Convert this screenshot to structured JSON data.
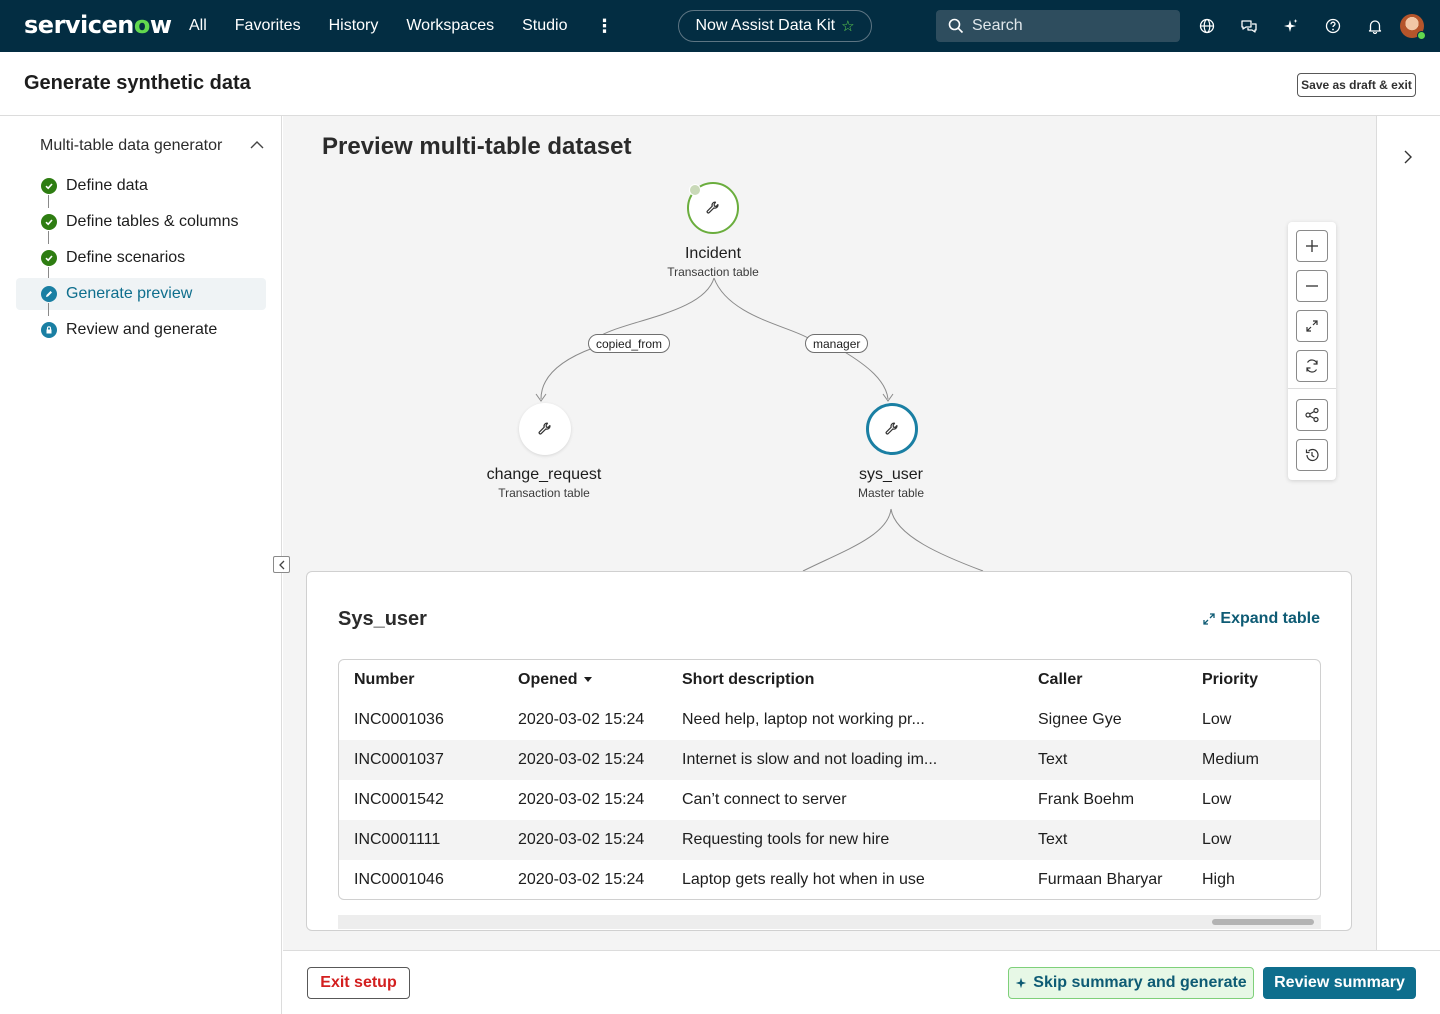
{
  "nav": {
    "logo_prefix": "servicen",
    "logo_o": "o",
    "logo_suffix": "w",
    "links": [
      "All",
      "Favorites",
      "History",
      "Workspaces",
      "Studio"
    ],
    "pill_label": "Now Assist Data Kit",
    "search_placeholder": "Search",
    "icons": [
      "globe-icon",
      "chat-icon",
      "sparkle-icon",
      "help-icon",
      "bell-icon"
    ]
  },
  "header": {
    "title": "Generate synthetic data",
    "save_label": "Save as draft & exit"
  },
  "sidebar": {
    "heading": "Multi-table data generator",
    "steps": [
      {
        "label": "Define data",
        "status": "complete"
      },
      {
        "label": "Define tables & columns",
        "status": "complete"
      },
      {
        "label": "Define scenarios",
        "status": "complete"
      },
      {
        "label": "Generate preview",
        "status": "current"
      },
      {
        "label": "Review and generate",
        "status": "locked"
      }
    ]
  },
  "main": {
    "title": "Preview multi-table dataset",
    "graph": {
      "nodes": [
        {
          "name": "Incident",
          "sub": "Transaction table"
        },
        {
          "name": "change_request",
          "sub": "Transaction table"
        },
        {
          "name": "sys_user",
          "sub": "Master table"
        }
      ],
      "edges": [
        "copied_from",
        "manager"
      ]
    },
    "table": {
      "title": "Sys_user",
      "expand_label": "Expand table",
      "columns": [
        "Number",
        "Opened",
        "Short description",
        "Caller",
        "Priority"
      ],
      "rows": [
        [
          "INC0001036",
          "2020-03-02 15:24",
          "Need help, laptop not working pr...",
          "Signee Gye",
          "Low"
        ],
        [
          "INC0001037",
          "2020-03-02 15:24",
          "Internet is slow and not loading im...",
          "Text",
          "Medium"
        ],
        [
          "INC0001542",
          "2020-03-02 15:24",
          "Can’t connect to server",
          "Frank Boehm",
          "Low"
        ],
        [
          "INC0001111",
          "2020-03-02 15:24",
          "Requesting tools for new hire",
          "Text",
          "Low"
        ],
        [
          "INC0001046",
          "2020-03-02 15:24",
          "Laptop gets really hot when in use",
          "Furmaan Bharyar",
          "High"
        ]
      ]
    }
  },
  "footer": {
    "exit_label": "Exit setup",
    "skip_label": "Skip summary and generate",
    "review_label": "Review summary"
  },
  "colors": {
    "nav_bg": "#032d42",
    "brand_green": "#62d84e",
    "primary": "#0e6e8d",
    "danger": "#d31f1f",
    "complete": "#2e7d12"
  }
}
